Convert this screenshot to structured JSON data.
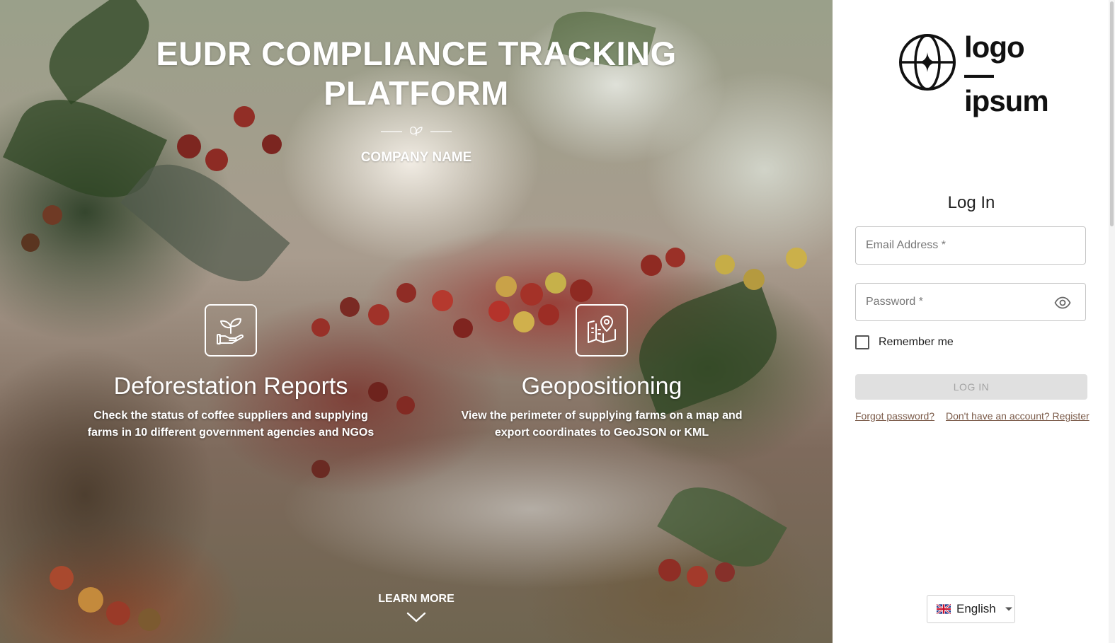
{
  "hero": {
    "title": "EUDR COMPLIANCE TRACKING PLATFORM",
    "company_name": "COMPANY NAME",
    "features": [
      {
        "icon": "plant-hand-icon",
        "title": "Deforestation Reports",
        "description": "Check the status of coffee suppliers and supplying farms in 10 different government agencies and NGOs"
      },
      {
        "icon": "map-location-icon",
        "title": "Geopositioning",
        "description": "View the perimeter of supplying farms on a map and export coordinates to GeoJSON or KML"
      }
    ],
    "learn_more": "LEARN MORE"
  },
  "login": {
    "logo_text_line1": "logo—",
    "logo_text_line2": "ipsum",
    "title": "Log In",
    "email_placeholder": "Email Address *",
    "password_placeholder": "Password *",
    "remember_label": "Remember me",
    "login_button": "LOG IN",
    "forgot_password": "Forgot password?",
    "register": "Don't have an account? Register",
    "language": "English"
  },
  "colors": {
    "link": "#7a5a48",
    "button_disabled_bg": "#e0e0e0",
    "button_disabled_text": "#a3a3a3"
  }
}
